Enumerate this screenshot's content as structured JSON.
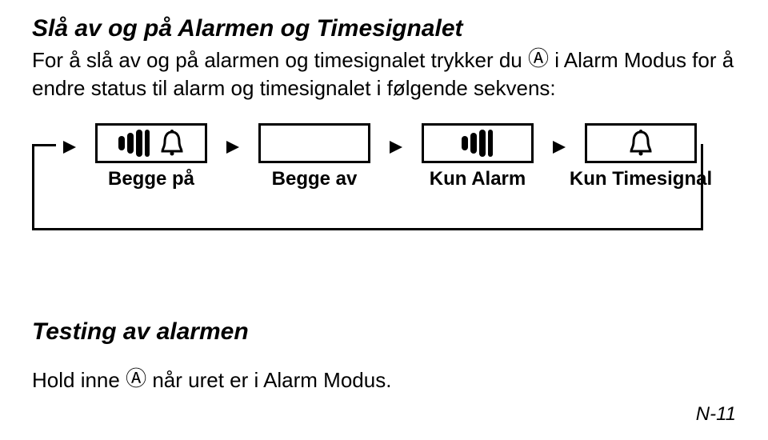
{
  "section1": {
    "title": "Slå av og på Alarmen og Timesignalet",
    "instr_pre": "For å slå av og på alarmen og timesignalet trykker du ",
    "button_letter": "Ⓐ",
    "instr_post": " i Alarm Modus for å endre status til alarm og timesignalet i følgende sekvens:"
  },
  "diagram": {
    "states": [
      {
        "label": "Begge på",
        "wave": true,
        "bell": true
      },
      {
        "label": "Begge av",
        "wave": false,
        "bell": false
      },
      {
        "label": "Kun Alarm",
        "wave": true,
        "bell": false
      },
      {
        "label": "Kun Timesignal",
        "wave": false,
        "bell": true
      }
    ]
  },
  "section2": {
    "title": "Testing av alarmen",
    "body_pre": "Hold inne ",
    "button_letter": "Ⓐ",
    "body_post": " når uret er i Alarm Modus."
  },
  "page_number": "N-11"
}
